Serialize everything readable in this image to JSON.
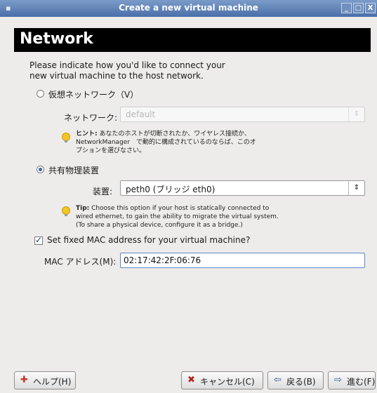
{
  "window": {
    "title": "Create a new virtual machine",
    "controls": [
      "_",
      "□",
      "X"
    ]
  },
  "page": {
    "heading": "Network",
    "intro_line1": "Please indicate how you'd like to connect your",
    "intro_line2": "new virtual machine to the host network."
  },
  "virtual_network": {
    "radio_label": "仮想ネットワーク（V）",
    "selected": false,
    "network_label": "ネットワーク:",
    "network_value": "default",
    "hint_label": "ヒント:",
    "hint_line1": "あなたのホストが切断されたか、ワイヤレス接続か、",
    "hint_line2": "NetworkManager　で動的に構成されているのならば、このオ",
    "hint_line3": "プションを選びなさい。"
  },
  "shared_device": {
    "radio_label": "共有物理装置",
    "selected": true,
    "device_label": "装置:",
    "device_value": "peth0 (ブリッジ eth0)",
    "tip_label": "Tip:",
    "tip_line1": "Choose this option if your host is statically connected to",
    "tip_line2": "wired ethernet, to gain the ability to migrate the virtual system.",
    "tip_line3": "(To share a physical device, configure it as a bridge.)"
  },
  "mac": {
    "checkbox_label": "Set fixed MAC address for your virtual machine?",
    "checked": true,
    "field_label": "MAC アドレス(M):",
    "value": "02:17:42:2F:06:76"
  },
  "footer": {
    "help_label": "ヘルプ(H)",
    "cancel_label": "キャンセル(C)",
    "back_label": "戻る(B)",
    "forward_label": "進む(F)"
  },
  "colors": {
    "titlebar": "#4a6ea8",
    "header_bg": "#000000",
    "window_bg": "#edeceb",
    "radio_on": "#3a63a8",
    "hint_bulb": "#f3c623"
  }
}
